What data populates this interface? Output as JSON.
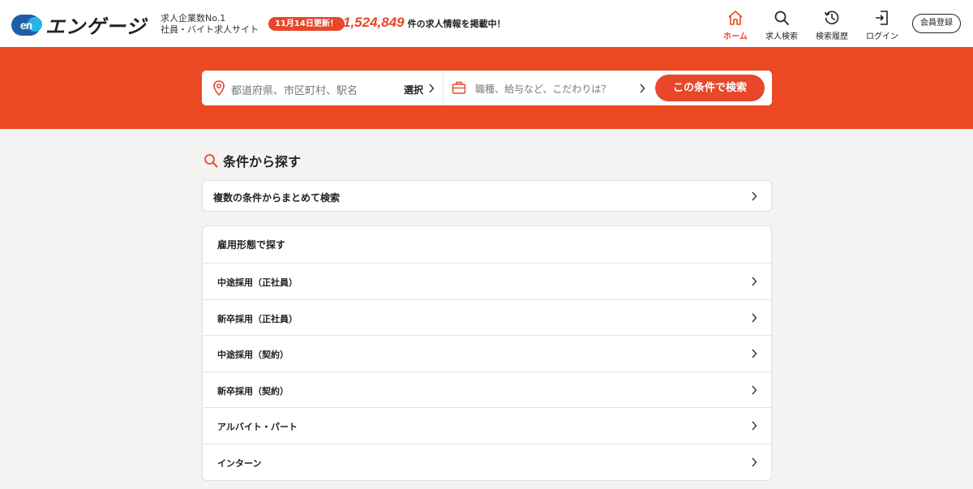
{
  "brand": {
    "logo_mark": "en",
    "logo_text": "エンゲージ"
  },
  "tagline": {
    "line1": "求人企業数No.1",
    "line2": "社員・バイト求人サイト"
  },
  "update_badge": "11月14日更新！",
  "job_count": {
    "number": "1,524,849",
    "suffix": "件の求人情報を掲載中！"
  },
  "nav": {
    "items": [
      {
        "label": "ホーム",
        "icon": "home-icon",
        "active": true
      },
      {
        "label": "求人検索",
        "icon": "search-icon"
      },
      {
        "label": "検索履歴",
        "icon": "history-icon"
      },
      {
        "label": "ログイン",
        "icon": "login-icon"
      }
    ],
    "register_label": "会員登録"
  },
  "search": {
    "location_placeholder": "都道府県、市区町村、駅名",
    "select_label": "選択",
    "job_placeholder": "職種、給与など、こだわりは？",
    "submit_label": "この条件で検索"
  },
  "conditions": {
    "heading": "条件から探す",
    "multi_label": "複数の条件からまとめて検索"
  },
  "employment": {
    "title": "雇用形態で探す",
    "items": [
      {
        "label": "中途採用（正社員）"
      },
      {
        "label": "新卒採用（正社員）"
      },
      {
        "label": "中途採用（契約）"
      },
      {
        "label": "新卒採用（契約）"
      },
      {
        "label": "アルバイト・パート"
      },
      {
        "label": "インターン"
      }
    ]
  },
  "colors": {
    "accent": "#e8472a",
    "hero_bg": "#ec4823",
    "logo_blue": "#1f5fa8",
    "logo_cyan": "#27b3e6"
  }
}
